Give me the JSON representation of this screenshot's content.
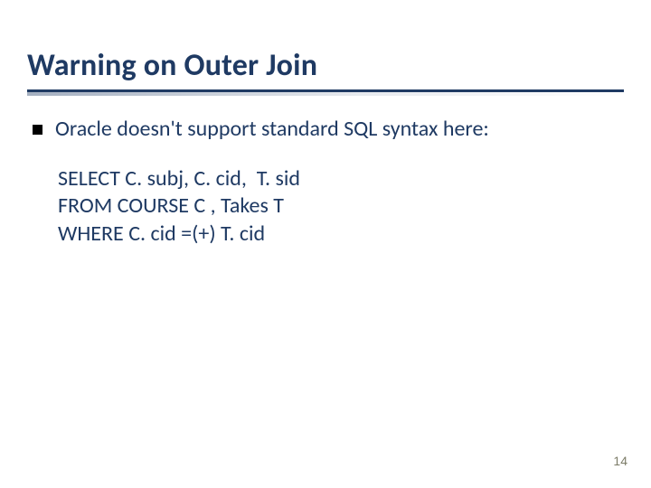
{
  "slide": {
    "title": "Warning on Outer Join",
    "bullet": "Oracle doesn't support standard SQL syntax here:",
    "code": {
      "line1": "SELECT C. subj, C. cid,  T. sid",
      "line2": "FROM COURSE C , Takes T",
      "line3": "WHERE C. cid =(+) T. cid"
    },
    "page_number": "14"
  }
}
